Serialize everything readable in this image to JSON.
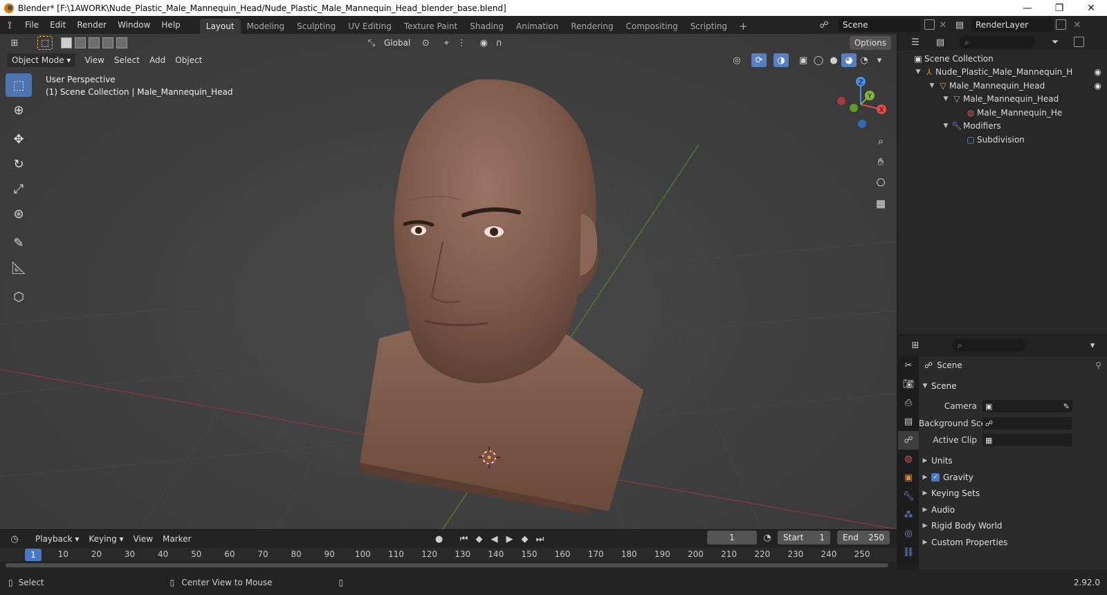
{
  "window": {
    "title": "Blender* [F:\\1AWORK\\Nude_Plastic_Male_Mannequin_Head/Nude_Plastic_Male_Mannequin_Head_blender_base.blend]",
    "minimize": "—",
    "maximize": "❐",
    "close": "✕"
  },
  "menu": {
    "file": "File",
    "edit": "Edit",
    "render": "Render",
    "window": "Window",
    "help": "Help"
  },
  "workspaces": [
    "Layout",
    "Modeling",
    "Sculpting",
    "UV Editing",
    "Texture Paint",
    "Shading",
    "Animation",
    "Rendering",
    "Compositing",
    "Scripting"
  ],
  "active_workspace": "Layout",
  "scene_name": "Scene",
  "view_layer": "RenderLayer",
  "viewport": {
    "mode": "Object Mode",
    "menus": [
      "View",
      "Select",
      "Add",
      "Object"
    ],
    "transform_orientation": "Global",
    "options_label": "Options",
    "overlay_line1": "User Perspective",
    "overlay_line2": "(1) Scene Collection | Male_Mannequin_Head",
    "gizmo": {
      "z": "Z",
      "y": "Y",
      "x": "X"
    }
  },
  "timeline": {
    "menus": [
      "Playback",
      "Keying",
      "View",
      "Marker"
    ],
    "current_frame": "1",
    "start_label": "Start",
    "start": "1",
    "end_label": "End",
    "end": "250",
    "ticks": [
      "1",
      "10",
      "20",
      "30",
      "40",
      "50",
      "60",
      "70",
      "80",
      "90",
      "100",
      "110",
      "120",
      "130",
      "140",
      "150",
      "160",
      "170",
      "180",
      "190",
      "200",
      "210",
      "220",
      "230",
      "240",
      "250"
    ]
  },
  "status": {
    "select": "Select",
    "center_view": "Center View to Mouse",
    "version": "2.92.0"
  },
  "outliner": {
    "root": "Scene Collection",
    "collection": "Nude_Plastic_Male_Mannequin_H",
    "object": "Male_Mannequin_Head",
    "mesh": "Male_Mannequin_Head",
    "material": "Male_Mannequin_He",
    "modifiers": "Modifiers",
    "modifier": "Subdivision"
  },
  "properties": {
    "context": "Scene",
    "panel_scene": "Scene",
    "camera_label": "Camera",
    "bg_scene_label": "Background Sce...",
    "active_clip_label": "Active Clip",
    "panels": [
      "Units",
      "Gravity",
      "Keying Sets",
      "Audio",
      "Rigid Body World",
      "Custom Properties"
    ]
  },
  "colors": {
    "accent": "#4a77c6",
    "x_axis": "#e24b4b",
    "y_axis": "#7fb538",
    "z_axis": "#4a8fe0"
  }
}
